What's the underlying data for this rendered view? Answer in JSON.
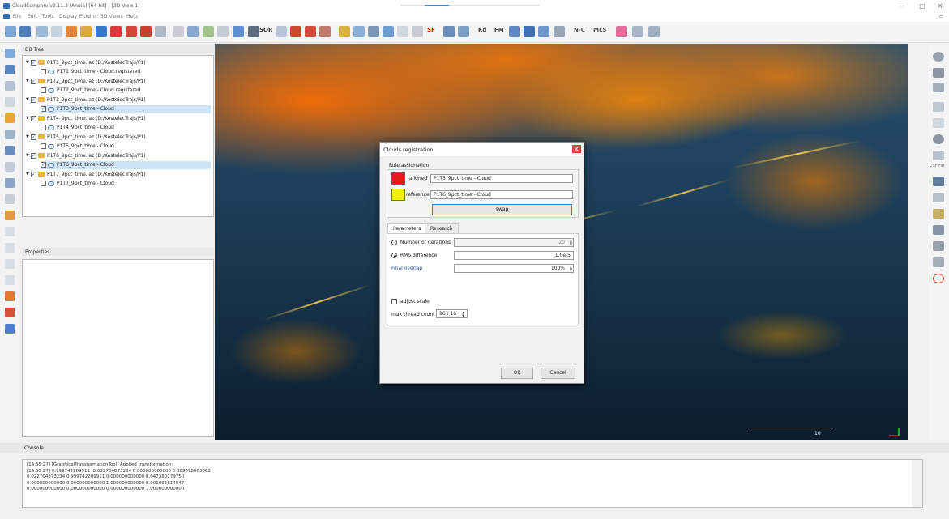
{
  "window": {
    "title": "CloudCompare v2.11.3 (Anoia) [64-bit] - [3D View 1]",
    "menu": [
      "File",
      "Edit",
      "Tools",
      "Display",
      "Plugins",
      "3D Views",
      "Help"
    ],
    "controls": [
      "—",
      "▢",
      "✕"
    ],
    "mdi_controls": "_ ▫"
  },
  "toolbar": {
    "sor_label": "SOR",
    "sf_label": "SF",
    "kd_label": "Kd",
    "fm_label": "FM",
    "nc_label": "N-C",
    "mls_label": "MLS"
  },
  "db_tree": {
    "title": "DB Tree",
    "items": [
      {
        "label": "P1T1_9pct_time.laz (D:/KostelecTrajs/P1)",
        "level": 0,
        "checked": true,
        "selected": false
      },
      {
        "label": "P1T1_9pct_time - Cloud.registered",
        "level": 1,
        "checked": false,
        "selected": false
      },
      {
        "label": "P1T2_9pct_time.laz (D:/KostelecTrajs/P1)",
        "level": 0,
        "checked": true,
        "selected": false
      },
      {
        "label": "P1T2_9pct_time - Cloud.registered",
        "level": 1,
        "checked": false,
        "selected": false
      },
      {
        "label": "P1T3_9pct_time.laz (D:/KostelecTrajs/P1)",
        "level": 0,
        "checked": true,
        "selected": false
      },
      {
        "label": "P1T3_9pct_time - Cloud",
        "level": 1,
        "checked": true,
        "selected": true
      },
      {
        "label": "P1T4_9pct_time.laz (D:/KostelecTrajs/P1)",
        "level": 0,
        "checked": true,
        "selected": false
      },
      {
        "label": "P1T4_9pct_time - Cloud",
        "level": 1,
        "checked": false,
        "selected": false
      },
      {
        "label": "P1T5_9pct_time.laz (D:/KostelecTrajs/P1)",
        "level": 0,
        "checked": true,
        "selected": false
      },
      {
        "label": "P1T5_9pct_time - Cloud",
        "level": 1,
        "checked": false,
        "selected": false
      },
      {
        "label": "P1T6_9pct_time.laz (D:/KostelecTrajs/P1)",
        "level": 0,
        "checked": true,
        "selected": false
      },
      {
        "label": "P1T6_9pct_time - Cloud",
        "level": 1,
        "checked": true,
        "selected": true
      },
      {
        "label": "P1T7_9pct_time.laz (D:/KostelecTrajs/P1)",
        "level": 0,
        "checked": true,
        "selected": false
      },
      {
        "label": "P1T7_9pct_time - Cloud",
        "level": 1,
        "checked": false,
        "selected": false
      }
    ]
  },
  "properties": {
    "title": "Properties"
  },
  "view": {
    "scale_label": "10",
    "csf_label": "CSF Filt"
  },
  "console": {
    "title": "Console",
    "lines": [
      "[14:55:27] [GraphicalTransformationTool] Applied transformation:",
      "[14:55:27] 0.999742209911 -0.022704873234 0.000000000000 0.069078803062",
      "0.022704873234 0.999742209911 0.000000000000 0.047380279750",
      "0.000000000000 0.000000000000 1.000000000000 0.001095614047",
      "0.000000000000 0.000000000000 0.000000000000 1.000000000000"
    ]
  },
  "dialog": {
    "title": "Clouds registration",
    "close": "x",
    "role_section": "Role assignation",
    "aligned_label": "aligned",
    "aligned_value": "P1T3_9pct_time - Cloud",
    "aligned_color": "#e21b1b",
    "reference_label": "reference",
    "reference_value": "P1T6_9pct_time - Cloud",
    "reference_color": "#f2f200",
    "swap_label": "swap",
    "tabs": [
      "Parameters",
      "Research"
    ],
    "iterations_label": "Number of iterations",
    "iterations_value": "20",
    "rms_label": "RMS difference",
    "rms_value": "1.0e-5",
    "overlap_label": "Final overlap",
    "overlap_value": "100%",
    "adjust_scale_label": "adjust scale",
    "thread_label": "max thread count",
    "thread_value": "16 / 16",
    "ok_label": "OK",
    "cancel_label": "Cancel"
  }
}
